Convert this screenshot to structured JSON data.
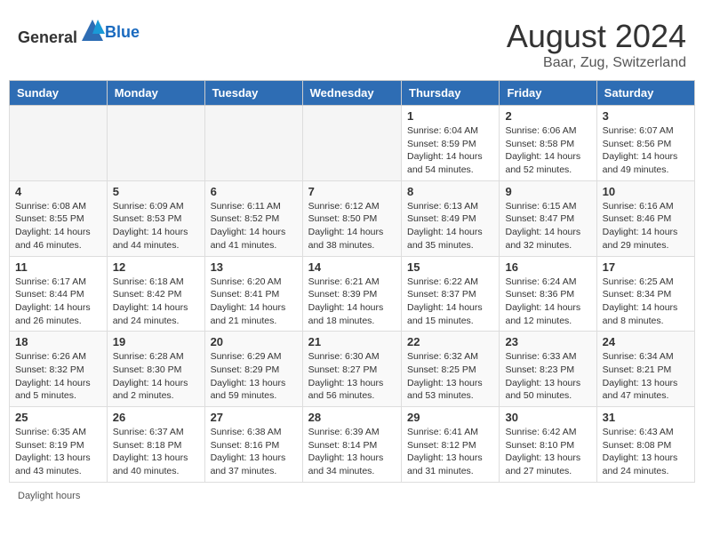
{
  "header": {
    "logo_general": "General",
    "logo_blue": "Blue",
    "month_title": "August 2024",
    "location": "Baar, Zug, Switzerland"
  },
  "days_of_week": [
    "Sunday",
    "Monday",
    "Tuesday",
    "Wednesday",
    "Thursday",
    "Friday",
    "Saturday"
  ],
  "weeks": [
    [
      {
        "day": "",
        "info": ""
      },
      {
        "day": "",
        "info": ""
      },
      {
        "day": "",
        "info": ""
      },
      {
        "day": "",
        "info": ""
      },
      {
        "day": "1",
        "info": "Sunrise: 6:04 AM\nSunset: 8:59 PM\nDaylight: 14 hours and 54 minutes."
      },
      {
        "day": "2",
        "info": "Sunrise: 6:06 AM\nSunset: 8:58 PM\nDaylight: 14 hours and 52 minutes."
      },
      {
        "day": "3",
        "info": "Sunrise: 6:07 AM\nSunset: 8:56 PM\nDaylight: 14 hours and 49 minutes."
      }
    ],
    [
      {
        "day": "4",
        "info": "Sunrise: 6:08 AM\nSunset: 8:55 PM\nDaylight: 14 hours and 46 minutes."
      },
      {
        "day": "5",
        "info": "Sunrise: 6:09 AM\nSunset: 8:53 PM\nDaylight: 14 hours and 44 minutes."
      },
      {
        "day": "6",
        "info": "Sunrise: 6:11 AM\nSunset: 8:52 PM\nDaylight: 14 hours and 41 minutes."
      },
      {
        "day": "7",
        "info": "Sunrise: 6:12 AM\nSunset: 8:50 PM\nDaylight: 14 hours and 38 minutes."
      },
      {
        "day": "8",
        "info": "Sunrise: 6:13 AM\nSunset: 8:49 PM\nDaylight: 14 hours and 35 minutes."
      },
      {
        "day": "9",
        "info": "Sunrise: 6:15 AM\nSunset: 8:47 PM\nDaylight: 14 hours and 32 minutes."
      },
      {
        "day": "10",
        "info": "Sunrise: 6:16 AM\nSunset: 8:46 PM\nDaylight: 14 hours and 29 minutes."
      }
    ],
    [
      {
        "day": "11",
        "info": "Sunrise: 6:17 AM\nSunset: 8:44 PM\nDaylight: 14 hours and 26 minutes."
      },
      {
        "day": "12",
        "info": "Sunrise: 6:18 AM\nSunset: 8:42 PM\nDaylight: 14 hours and 24 minutes."
      },
      {
        "day": "13",
        "info": "Sunrise: 6:20 AM\nSunset: 8:41 PM\nDaylight: 14 hours and 21 minutes."
      },
      {
        "day": "14",
        "info": "Sunrise: 6:21 AM\nSunset: 8:39 PM\nDaylight: 14 hours and 18 minutes."
      },
      {
        "day": "15",
        "info": "Sunrise: 6:22 AM\nSunset: 8:37 PM\nDaylight: 14 hours and 15 minutes."
      },
      {
        "day": "16",
        "info": "Sunrise: 6:24 AM\nSunset: 8:36 PM\nDaylight: 14 hours and 12 minutes."
      },
      {
        "day": "17",
        "info": "Sunrise: 6:25 AM\nSunset: 8:34 PM\nDaylight: 14 hours and 8 minutes."
      }
    ],
    [
      {
        "day": "18",
        "info": "Sunrise: 6:26 AM\nSunset: 8:32 PM\nDaylight: 14 hours and 5 minutes."
      },
      {
        "day": "19",
        "info": "Sunrise: 6:28 AM\nSunset: 8:30 PM\nDaylight: 14 hours and 2 minutes."
      },
      {
        "day": "20",
        "info": "Sunrise: 6:29 AM\nSunset: 8:29 PM\nDaylight: 13 hours and 59 minutes."
      },
      {
        "day": "21",
        "info": "Sunrise: 6:30 AM\nSunset: 8:27 PM\nDaylight: 13 hours and 56 minutes."
      },
      {
        "day": "22",
        "info": "Sunrise: 6:32 AM\nSunset: 8:25 PM\nDaylight: 13 hours and 53 minutes."
      },
      {
        "day": "23",
        "info": "Sunrise: 6:33 AM\nSunset: 8:23 PM\nDaylight: 13 hours and 50 minutes."
      },
      {
        "day": "24",
        "info": "Sunrise: 6:34 AM\nSunset: 8:21 PM\nDaylight: 13 hours and 47 minutes."
      }
    ],
    [
      {
        "day": "25",
        "info": "Sunrise: 6:35 AM\nSunset: 8:19 PM\nDaylight: 13 hours and 43 minutes."
      },
      {
        "day": "26",
        "info": "Sunrise: 6:37 AM\nSunset: 8:18 PM\nDaylight: 13 hours and 40 minutes."
      },
      {
        "day": "27",
        "info": "Sunrise: 6:38 AM\nSunset: 8:16 PM\nDaylight: 13 hours and 37 minutes."
      },
      {
        "day": "28",
        "info": "Sunrise: 6:39 AM\nSunset: 8:14 PM\nDaylight: 13 hours and 34 minutes."
      },
      {
        "day": "29",
        "info": "Sunrise: 6:41 AM\nSunset: 8:12 PM\nDaylight: 13 hours and 31 minutes."
      },
      {
        "day": "30",
        "info": "Sunrise: 6:42 AM\nSunset: 8:10 PM\nDaylight: 13 hours and 27 minutes."
      },
      {
        "day": "31",
        "info": "Sunrise: 6:43 AM\nSunset: 8:08 PM\nDaylight: 13 hours and 24 minutes."
      }
    ]
  ],
  "footer": {
    "note": "Daylight hours"
  }
}
